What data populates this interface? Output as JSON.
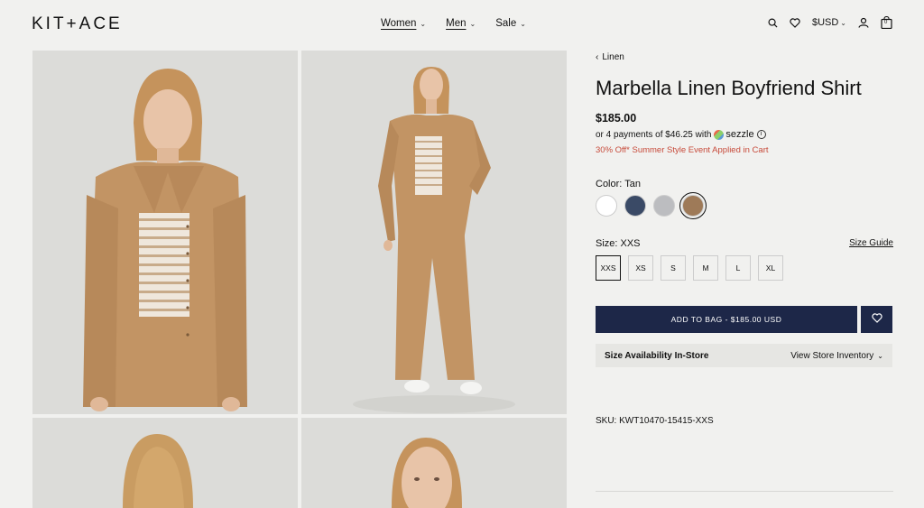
{
  "brand": "KIT+ACE",
  "nav": [
    {
      "label": "Women",
      "underlined": true
    },
    {
      "label": "Men",
      "underlined": true
    },
    {
      "label": "Sale",
      "underlined": false
    }
  ],
  "header": {
    "currency": "$USD",
    "cart_count": "0"
  },
  "breadcrumb": "Linen",
  "product": {
    "title": "Marbella Linen Boyfriend Shirt",
    "price": "$185.00",
    "installments_text": "or 4 payments of $46.25 with",
    "installments_brand": "sezzle",
    "promo": "30% Off* Summer Style Event Applied in Cart",
    "color_label": "Color: Tan",
    "colors": [
      {
        "name": "White",
        "hex": "#ffffff",
        "selected": false
      },
      {
        "name": "Navy",
        "hex": "#3a4a66",
        "selected": false
      },
      {
        "name": "Grey",
        "hex": "#bcbdc0",
        "selected": false
      },
      {
        "name": "Tan",
        "hex": "#9e7a58",
        "selected": true
      }
    ],
    "size_label": "Size: XXS",
    "size_guide": "Size Guide",
    "sizes": [
      "XXS",
      "XS",
      "S",
      "M",
      "L",
      "XL"
    ],
    "selected_size": "XXS",
    "add_to_bag": "ADD TO BAG - $185.00 USD",
    "availability_label": "Size Availability In-Store",
    "availability_link": "View Store Inventory",
    "sku": "SKU: KWT10470-15415-XXS"
  },
  "colors": {
    "navy_button": "#1d2748",
    "promo": "#c74a3a",
    "background": "#f1f1ef"
  }
}
